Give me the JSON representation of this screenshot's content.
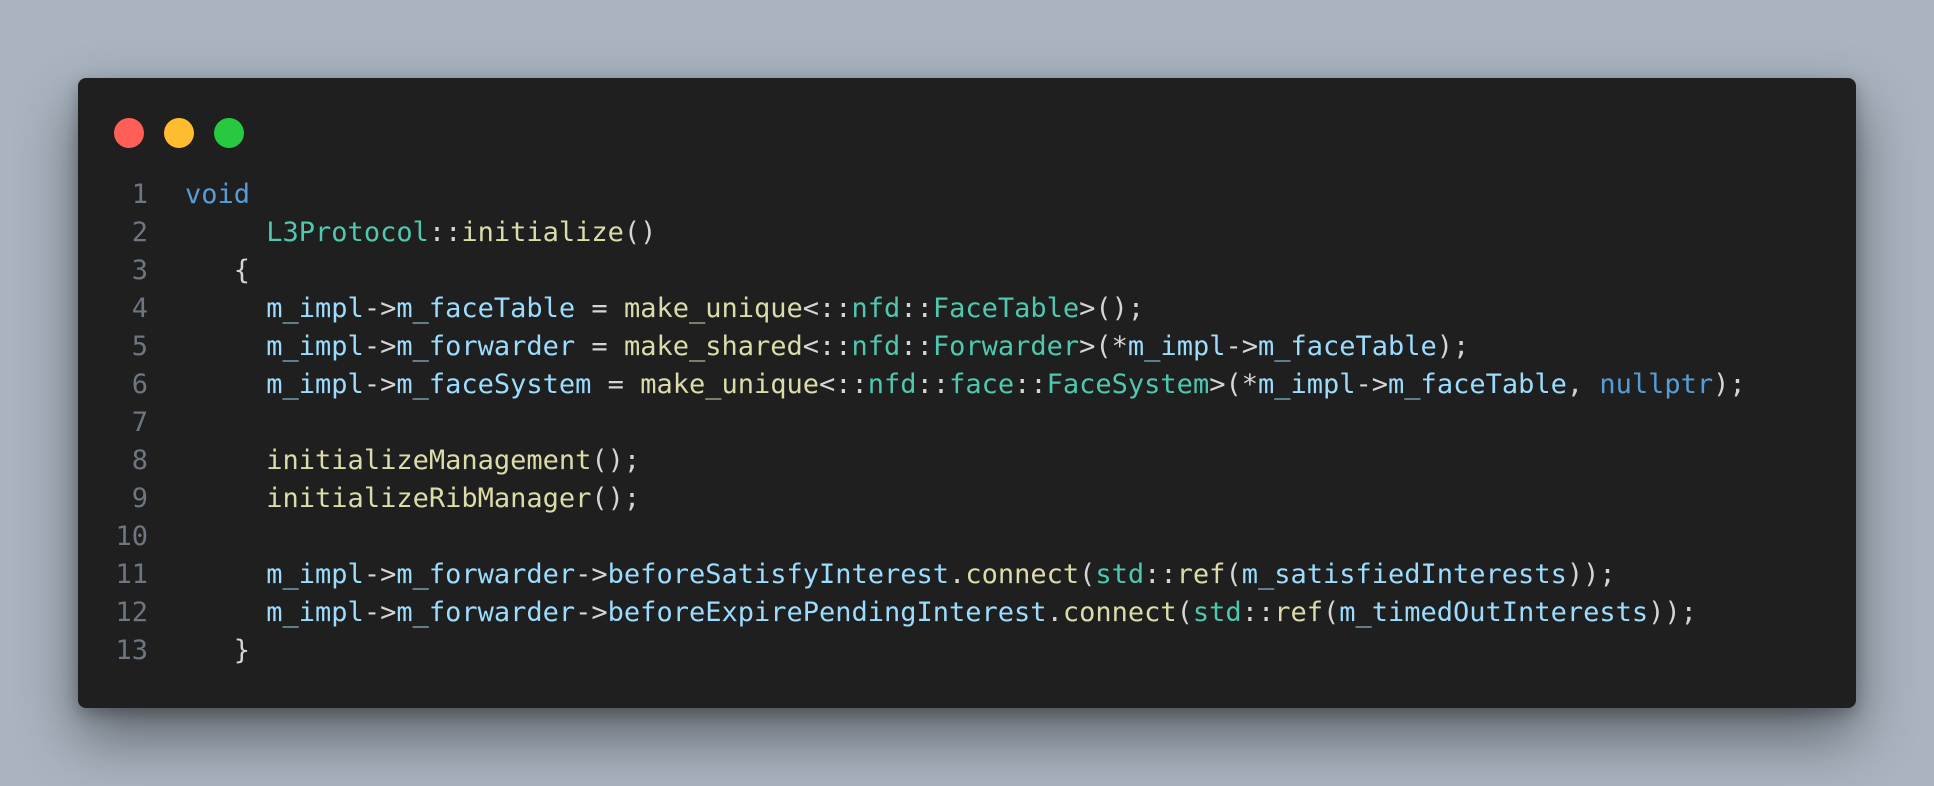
{
  "window": {
    "controls": [
      {
        "name": "close",
        "color": "#ff5f57"
      },
      {
        "name": "minimize",
        "color": "#febc2e"
      },
      {
        "name": "zoom",
        "color": "#28c840"
      }
    ]
  },
  "theme": {
    "background": "#1f1f1f",
    "line_number": "#6e7681",
    "keyword": "#569cd6",
    "type": "#4ec9b0",
    "function": "#dcdcaa",
    "variable": "#9cdcfe",
    "punctuation": "#d4d4d4"
  },
  "code": {
    "language": "cpp",
    "lines": [
      {
        "n": "1",
        "tokens": [
          [
            "keyword",
            "void"
          ]
        ]
      },
      {
        "n": "2",
        "tokens": [
          [
            "punc",
            "     "
          ],
          [
            "type",
            "L3Protocol"
          ],
          [
            "punc",
            "::"
          ],
          [
            "func",
            "initialize"
          ],
          [
            "punc",
            "()"
          ]
        ]
      },
      {
        "n": "3",
        "tokens": [
          [
            "punc",
            "   {"
          ]
        ]
      },
      {
        "n": "4",
        "tokens": [
          [
            "punc",
            "     "
          ],
          [
            "var",
            "m_impl"
          ],
          [
            "op",
            "->"
          ],
          [
            "var",
            "m_faceTable"
          ],
          [
            "op",
            " = "
          ],
          [
            "func",
            "make_unique"
          ],
          [
            "punc",
            "<::"
          ],
          [
            "type",
            "nfd"
          ],
          [
            "punc",
            "::"
          ],
          [
            "type",
            "FaceTable"
          ],
          [
            "punc",
            ">();"
          ]
        ]
      },
      {
        "n": "5",
        "tokens": [
          [
            "punc",
            "     "
          ],
          [
            "var",
            "m_impl"
          ],
          [
            "op",
            "->"
          ],
          [
            "var",
            "m_forwarder"
          ],
          [
            "op",
            " = "
          ],
          [
            "func",
            "make_shared"
          ],
          [
            "punc",
            "<::"
          ],
          [
            "type",
            "nfd"
          ],
          [
            "punc",
            "::"
          ],
          [
            "type",
            "Forwarder"
          ],
          [
            "punc",
            ">(*"
          ],
          [
            "var",
            "m_impl"
          ],
          [
            "op",
            "->"
          ],
          [
            "var",
            "m_faceTable"
          ],
          [
            "punc",
            ");"
          ]
        ]
      },
      {
        "n": "6",
        "tokens": [
          [
            "punc",
            "     "
          ],
          [
            "var",
            "m_impl"
          ],
          [
            "op",
            "->"
          ],
          [
            "var",
            "m_faceSystem"
          ],
          [
            "op",
            " = "
          ],
          [
            "func",
            "make_unique"
          ],
          [
            "punc",
            "<::"
          ],
          [
            "type",
            "nfd"
          ],
          [
            "punc",
            "::"
          ],
          [
            "type",
            "face"
          ],
          [
            "punc",
            "::"
          ],
          [
            "type",
            "FaceSystem"
          ],
          [
            "punc",
            ">(*"
          ],
          [
            "var",
            "m_impl"
          ],
          [
            "op",
            "->"
          ],
          [
            "var",
            "m_faceTable"
          ],
          [
            "punc",
            ", "
          ],
          [
            "keyword",
            "nullptr"
          ],
          [
            "punc",
            ");"
          ]
        ]
      },
      {
        "n": "7",
        "tokens": []
      },
      {
        "n": "8",
        "tokens": [
          [
            "punc",
            "     "
          ],
          [
            "func",
            "initializeManagement"
          ],
          [
            "punc",
            "();"
          ]
        ]
      },
      {
        "n": "9",
        "tokens": [
          [
            "punc",
            "     "
          ],
          [
            "func",
            "initializeRibManager"
          ],
          [
            "punc",
            "();"
          ]
        ]
      },
      {
        "n": "10",
        "tokens": []
      },
      {
        "n": "11",
        "tokens": [
          [
            "punc",
            "     "
          ],
          [
            "var",
            "m_impl"
          ],
          [
            "op",
            "->"
          ],
          [
            "var",
            "m_forwarder"
          ],
          [
            "op",
            "->"
          ],
          [
            "var",
            "beforeSatisfyInterest"
          ],
          [
            "punc",
            "."
          ],
          [
            "func",
            "connect"
          ],
          [
            "punc",
            "("
          ],
          [
            "type",
            "std"
          ],
          [
            "punc",
            "::"
          ],
          [
            "func",
            "ref"
          ],
          [
            "punc",
            "("
          ],
          [
            "var",
            "m_satisfiedInterests"
          ],
          [
            "punc",
            "));"
          ]
        ]
      },
      {
        "n": "12",
        "tokens": [
          [
            "punc",
            "     "
          ],
          [
            "var",
            "m_impl"
          ],
          [
            "op",
            "->"
          ],
          [
            "var",
            "m_forwarder"
          ],
          [
            "op",
            "->"
          ],
          [
            "var",
            "beforeExpirePendingInterest"
          ],
          [
            "punc",
            "."
          ],
          [
            "func",
            "connect"
          ],
          [
            "punc",
            "("
          ],
          [
            "type",
            "std"
          ],
          [
            "punc",
            "::"
          ],
          [
            "func",
            "ref"
          ],
          [
            "punc",
            "("
          ],
          [
            "var",
            "m_timedOutInterests"
          ],
          [
            "punc",
            "));"
          ]
        ]
      },
      {
        "n": "13",
        "tokens": [
          [
            "punc",
            "   }"
          ]
        ]
      }
    ]
  }
}
